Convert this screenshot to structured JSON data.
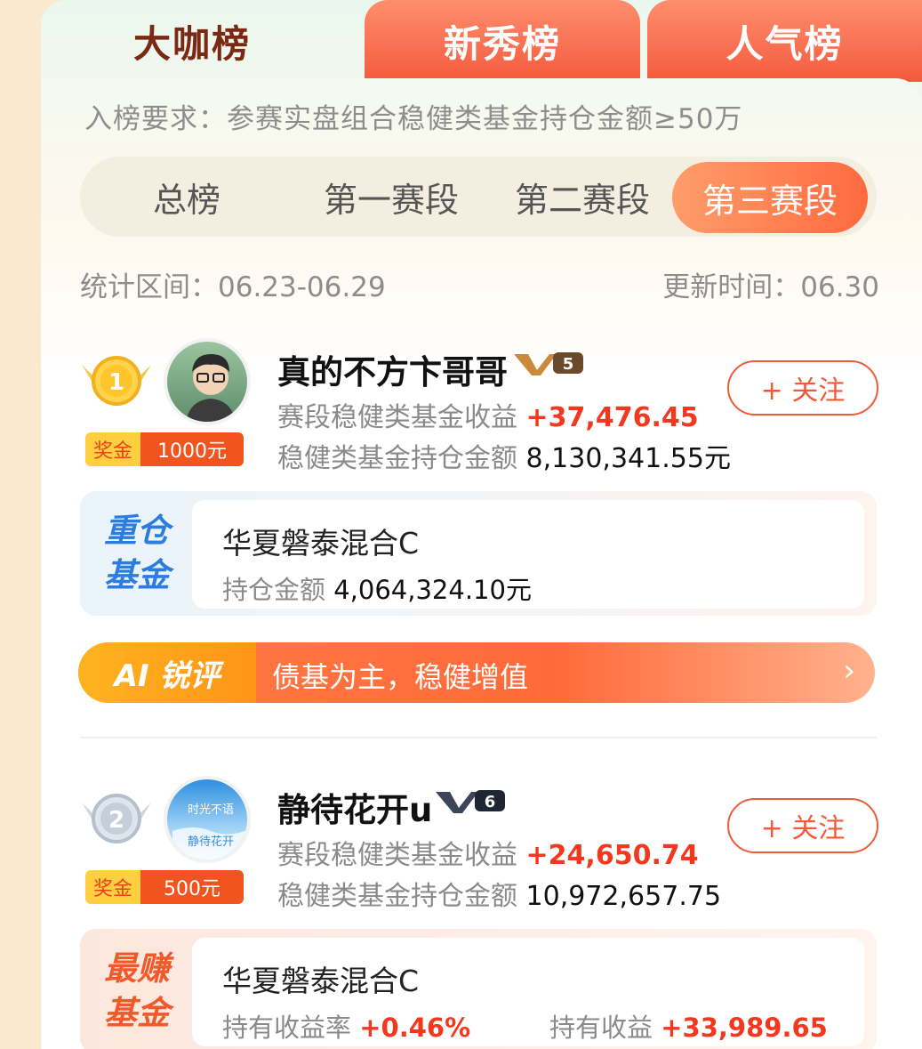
{
  "tabs": [
    "大咖榜",
    "新秀榜",
    "人气榜"
  ],
  "requirement": "入榜要求：参赛实盘组合稳健类基金持仓金额≥50万",
  "segments": [
    "总榜",
    "第一赛段",
    "第二赛段",
    "第三赛段"
  ],
  "active_segment": "第三赛段",
  "period": "统计区间：06.23-06.29",
  "updated": "更新时间：06.30",
  "entries": [
    {
      "rank": "1",
      "name": "真的不方卞哥哥",
      "level": "5",
      "prize_label": "奖金",
      "prize_value": "1000元",
      "return_label": "赛段稳健类基金收益",
      "return_value": "+37,476.45",
      "holding_label": "稳健类基金持仓金额",
      "holding_value": "8,130,341.55元",
      "follow": "+ 关注",
      "fund_tag_1": "重仓",
      "fund_tag_2": "基金",
      "fund_name": "华夏磐泰混合C",
      "fund_sub_label": "持仓金额",
      "fund_sub_value": "4,064,324.10元"
    },
    {
      "rank": "2",
      "name": "静待花开u",
      "level": "6",
      "prize_label": "奖金",
      "prize_value": "500元",
      "return_label": "赛段稳健类基金收益",
      "return_value": "+24,650.74",
      "holding_label": "稳健类基金持仓金额",
      "holding_value": "10,972,657.75",
      "follow": "+ 关注",
      "avatar_text_1": "时光不语",
      "avatar_text_2": "静待花开",
      "fund_tag_1": "最赚",
      "fund_tag_2": "基金",
      "fund_name": "华夏磐泰混合C",
      "fund_rate_label": "持有收益率",
      "fund_rate_value": "+0.46%",
      "fund_profit_label": "持有收益",
      "fund_profit_value": "+33,989.65"
    }
  ],
  "ai": {
    "tag": "AI 锐评",
    "text": "债基为主，稳健增值",
    "arrow": "›"
  },
  "colors": {
    "accent": "#f05a36",
    "positive": "#f2391f",
    "tab_active_text": "#7a2a14",
    "blue_tag": "#2d7de0"
  }
}
